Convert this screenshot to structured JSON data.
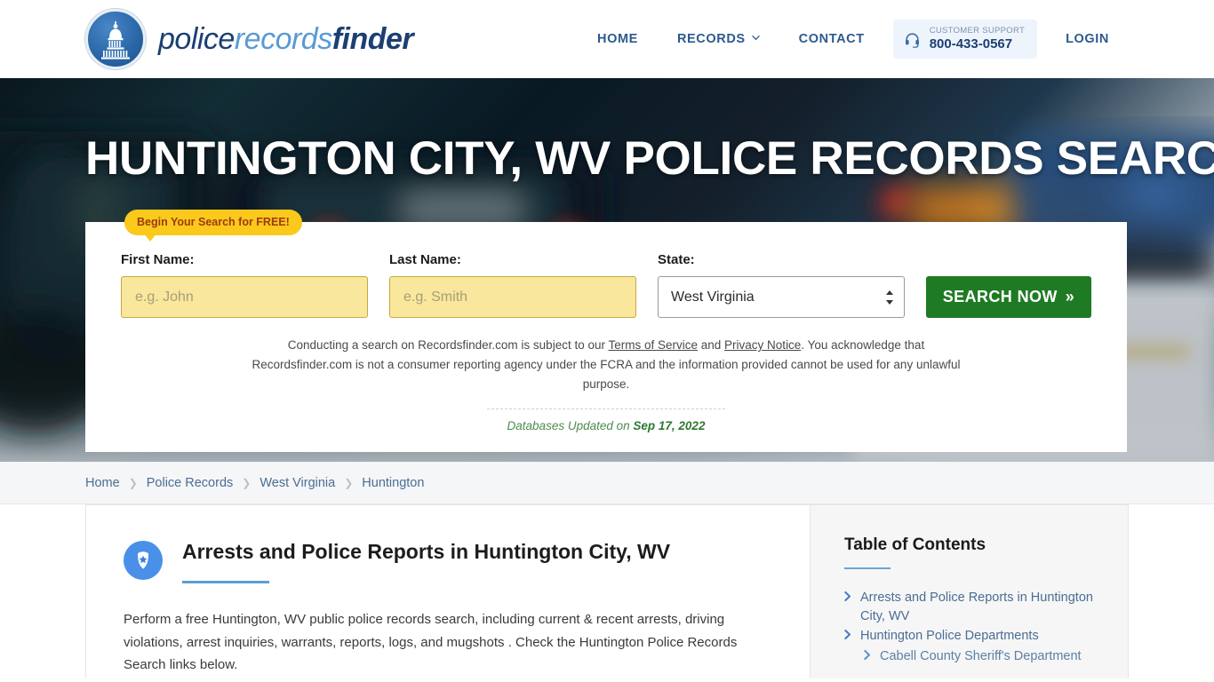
{
  "header": {
    "logo": {
      "icon": "capitol-dome-icon",
      "part1": "police",
      "part2": "records",
      "part3": "finder"
    },
    "nav": [
      {
        "label": "HOME",
        "name": "nav-home",
        "has_chevron": false
      },
      {
        "label": "RECORDS",
        "name": "nav-records",
        "has_chevron": true
      },
      {
        "label": "CONTACT",
        "name": "nav-contact",
        "has_chevron": false
      }
    ],
    "support": {
      "icon": "headset-icon",
      "label": "CUSTOMER SUPPORT",
      "phone": "800-433-0567"
    },
    "login_label": "LOGIN"
  },
  "hero": {
    "title": "HUNTINGTON CITY, WV POLICE RECORDS SEARCH",
    "background": "blurred-police-car-lights-photo"
  },
  "search": {
    "free_badge": "Begin Your Search for FREE!",
    "first_name": {
      "label": "First Name:",
      "placeholder": "e.g. John",
      "value": ""
    },
    "last_name": {
      "label": "Last Name:",
      "placeholder": "e.g. Smith",
      "value": ""
    },
    "state": {
      "label": "State:",
      "value": "West Virginia"
    },
    "button_label": "SEARCH NOW",
    "button_arrow": "»",
    "disclaimer_1": "Conducting a search on Recordsfinder.com is subject to our ",
    "disclaimer_link_1": "Terms of Service",
    "disclaimer_2": " and ",
    "disclaimer_link_2": "Privacy Notice",
    "disclaimer_3": ". You acknowledge that Recordsfinder.com is not a consumer reporting agency under the FCRA and the information provided cannot be used for any unlawful purpose.",
    "db_updated_label": "Databases Updated on ",
    "db_updated_date": "Sep 17, 2022"
  },
  "breadcrumb": [
    {
      "label": "Home",
      "name": "breadcrumb-home"
    },
    {
      "label": "Police Records",
      "name": "breadcrumb-police-records"
    },
    {
      "label": "West Virginia",
      "name": "breadcrumb-west-virginia"
    },
    {
      "label": "Huntington",
      "name": "breadcrumb-huntington"
    }
  ],
  "main": {
    "section_icon": "police-badge-icon",
    "section_title": "Arrests and Police Reports in Huntington City, WV",
    "paragraph": "Perform a free Huntington, WV public police records search, including current & recent arrests, driving violations, arrest inquiries, warrants, reports, logs, and mugshots . Check the Huntington Police Records Search links below."
  },
  "toc": {
    "title": "Table of Contents",
    "items": [
      {
        "label": "Arrests and Police Reports in Huntington City, WV",
        "sub": false
      },
      {
        "label": "Huntington Police Departments",
        "sub": false
      },
      {
        "label": "Cabell County Sheriff's Department",
        "sub": true
      }
    ]
  },
  "colors": {
    "brand_navy": "#1c3f73",
    "brand_blue": "#5a9ad4",
    "accent_yellow": "#fbc91b",
    "input_yellow": "#f8e79c",
    "search_green": "#1e7b24",
    "link_blue": "#4a6d94",
    "badge_blue": "#4a90e8"
  }
}
